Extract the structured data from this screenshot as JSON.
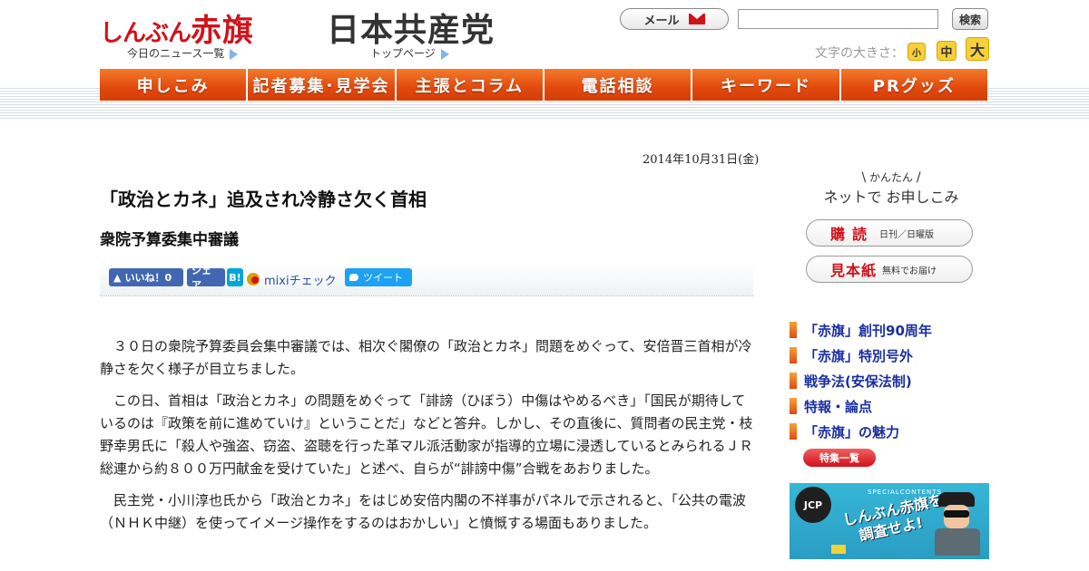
{
  "header": {
    "logo_hiragana": "しんぶん",
    "logo_kanji": "赤旗",
    "news_link": "今日のニュース一覧",
    "jcp_logo": "日本共産党",
    "top_link": "トップページ",
    "mail_label": "メール",
    "search_value": "",
    "search_button": "検索",
    "fontsize_label": "文字の大きさ：",
    "fontsize_small": "小",
    "fontsize_mid": "中",
    "fontsize_large": "大"
  },
  "nav": {
    "items": [
      {
        "label": "申しこみ"
      },
      {
        "label": "記者募集･見学会"
      },
      {
        "label": "主張とコラム"
      },
      {
        "label": "電話相談"
      },
      {
        "label": "キーワード"
      },
      {
        "label": "PRグッズ"
      }
    ]
  },
  "article": {
    "date": "2014年10月31日(金)",
    "headline": "「政治とカネ」追及され冷静さ欠く首相",
    "subhead": "衆院予算委集中審議",
    "paragraphs": [
      "３０日の衆院予算委員会集中審議では、相次ぐ閣僚の「政治とカネ」問題をめぐって、安倍晋三首相が冷静さを欠く様子が目立ちました。",
      "この日、首相は「政治とカネ」の問題をめぐって「誹謗（ひぼう）中傷はやめるべき」「国民が期待しているのは『政策を前に進めていけ』ということだ」などと答弁。しかし、その直後に、質問者の民主党・枝野幸男氏に「殺人や強盗、窃盗、盗聴を行った革マル派活動家が指導的立場に浸透しているとみられるＪＲ総連から約８００万円献金を受けていた」と述べ、自らが“誹謗中傷”合戦をあおりました。",
      "民主党・小川淳也氏から「政治とカネ」をはじめ安倍内閣の不祥事がパネルで示されると、「公共の電波（ＮＨＫ中継）を使ってイメージ操作をするのはおかしい」と憤慨する場面もありました。"
    ]
  },
  "share": {
    "like": "いいね！0",
    "share": "シェア",
    "hatena": "B!",
    "mixi": "mixiチェック",
    "tweet": "ツイート"
  },
  "sidebar": {
    "easy_small": "かんたん",
    "easy_big": "ネットで お申しこみ",
    "subscribe_big": "購読",
    "subscribe_small": "日刊／日曜版",
    "sample_big": "見本紙",
    "sample_small": "無料でお届け",
    "features": [
      {
        "label": "「赤旗」創刊90周年"
      },
      {
        "label": "「赤旗」特別号外"
      },
      {
        "label": "戦争法(安保法制)"
      },
      {
        "label": "特報・論点"
      },
      {
        "label": "「赤旗」の魅力"
      }
    ],
    "feature_list_button": "特集一覧",
    "banner": {
      "badge": "JCP",
      "special": "SPECIALCONTENTS",
      "line1": "しんぶん赤旗を",
      "line2": "調査せよ!"
    }
  },
  "colors": {
    "brand_red": "#d0121b",
    "nav_orange": "#e2480d",
    "link_blue": "#1a2fa0"
  }
}
